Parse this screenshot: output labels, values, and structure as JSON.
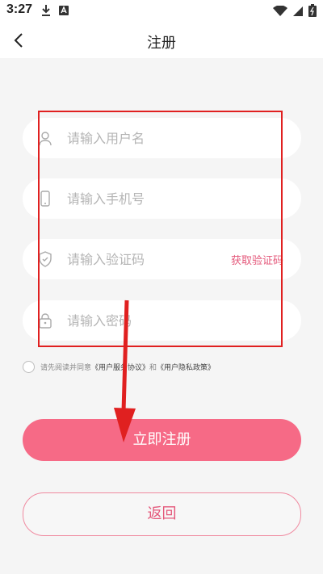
{
  "status_bar": {
    "time": "3:27"
  },
  "header": {
    "title": "注册"
  },
  "form": {
    "username": {
      "placeholder": "请输入用户名",
      "value": ""
    },
    "phone": {
      "placeholder": "请输入手机号",
      "value": ""
    },
    "code": {
      "placeholder": "请输入验证码",
      "value": "",
      "get_code_label": "获取验证码"
    },
    "password": {
      "placeholder": "请输入密码",
      "value": ""
    }
  },
  "agreement": {
    "prefix": "请先阅读并同意",
    "service_link": "《用户服务协议》",
    "and": "和",
    "privacy_link": "《用户隐私政策》"
  },
  "buttons": {
    "register": "立即注册",
    "return": "返回"
  },
  "colors": {
    "accent": "#f66a86",
    "link": "#e4577a",
    "annotation": "#e02020"
  }
}
